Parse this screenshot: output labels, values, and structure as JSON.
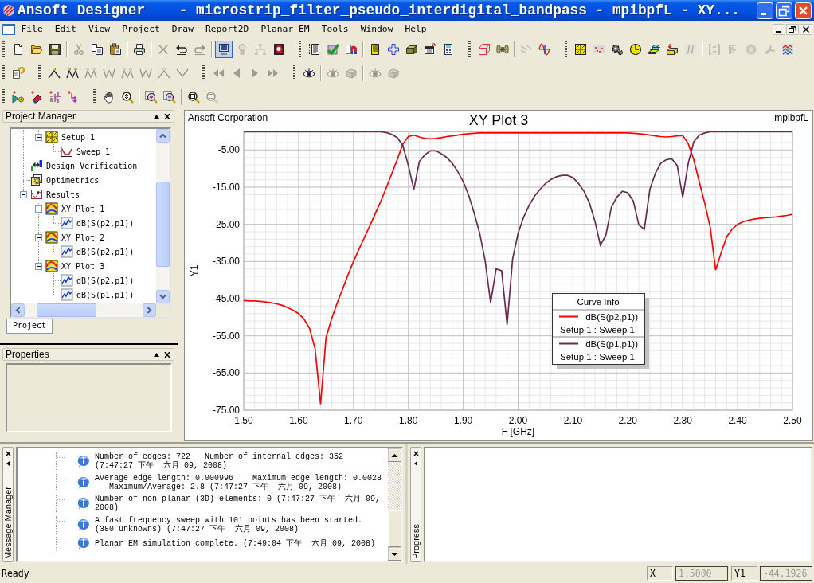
{
  "window": {
    "title": "Ansoft Designer    - microstrip_filter_pseudo_interdigital_bandpass - mpibpfL - XY..."
  },
  "menu_bar": {
    "items": [
      "File",
      "Edit",
      "View",
      "Project",
      "Draw",
      "Report2D",
      "Planar EM",
      "Tools",
      "Window",
      "Help"
    ]
  },
  "toolbars": [
    {
      "bands": [
        {
          "groups": [
            [
              {
                "disabled": false,
                "pressed": false
              },
              {
                "disabled": false,
                "pressed": false
              },
              {
                "disabled": false,
                "pressed": false
              }
            ],
            [
              {
                "disabled": true,
                "pressed": false
              },
              {
                "disabled": false,
                "pressed": false
              },
              {
                "disabled": false,
                "pressed": false
              }
            ],
            [
              {
                "disabled": false,
                "pressed": false
              }
            ],
            [
              {
                "disabled": true,
                "pressed": false
              },
              {
                "disabled": false,
                "pressed": false
              },
              {
                "disabled": true,
                "pressed": false
              }
            ],
            [
              {
                "disabled": false,
                "pressed": true
              },
              {
                "disabled": true,
                "pressed": false
              },
              {
                "disabled": true,
                "pressed": false
              },
              {
                "disabled": false,
                "pressed": false
              }
            ]
          ]
        },
        {
          "groups": [
            [
              {
                "disabled": false,
                "pressed": false
              },
              {
                "disabled": false,
                "pressed": false
              },
              {
                "disabled": false,
                "pressed": false
              }
            ],
            [
              {
                "disabled": false,
                "pressed": false
              },
              {
                "disabled": false,
                "pressed": false
              },
              {
                "disabled": false,
                "pressed": false
              },
              {
                "disabled": false,
                "pressed": false
              },
              {
                "disabled": false,
                "pressed": false
              }
            ]
          ]
        },
        {
          "groups": [
            [
              {
                "disabled": false,
                "pressed": false
              },
              {
                "disabled": false,
                "pressed": false
              }
            ],
            [
              {
                "disabled": true,
                "pressed": false
              },
              {
                "disabled": false,
                "pressed": false
              }
            ]
          ]
        },
        {
          "groups": [
            [
              {
                "disabled": false,
                "pressed": false
              },
              {
                "disabled": false,
                "pressed": false
              },
              {
                "disabled": false,
                "pressed": false
              },
              {
                "disabled": false,
                "pressed": false
              },
              {
                "disabled": false,
                "pressed": false
              },
              {
                "disabled": false,
                "pressed": false
              },
              {
                "disabled": true,
                "pressed": false
              }
            ],
            [
              {
                "disabled": true,
                "pressed": false
              },
              {
                "disabled": true,
                "pressed": false
              },
              {
                "disabled": true,
                "pressed": false
              },
              {
                "disabled": true,
                "pressed": false
              },
              {
                "disabled": false,
                "pressed": false
              }
            ]
          ]
        }
      ]
    },
    {
      "bands": [
        {
          "groups": [
            [
              {
                "disabled": false
              }
            ]
          ]
        },
        {
          "groups": [
            [
              {
                "disabled": false
              },
              {
                "disabled": false
              },
              {
                "disabled": true
              },
              {
                "disabled": true
              },
              {
                "disabled": true
              },
              {
                "disabled": true
              },
              {
                "disabled": true
              },
              {
                "disabled": true
              }
            ]
          ]
        },
        {
          "groups": [
            [
              {
                "disabled": true
              },
              {
                "disabled": true
              },
              {
                "disabled": true
              },
              {
                "disabled": true
              }
            ]
          ]
        },
        {
          "groups": [
            [
              {
                "disabled": false
              }
            ],
            [
              {
                "disabled": true
              },
              {
                "disabled": true
              }
            ],
            [
              {
                "disabled": true
              },
              {
                "disabled": true
              }
            ]
          ]
        }
      ]
    },
    {
      "bands": [
        {
          "groups": [
            [
              {
                "disabled": false
              },
              {
                "disabled": false
              },
              {
                "disabled": false
              },
              {
                "disabled": false
              }
            ]
          ]
        },
        {
          "groups": [
            [
              {
                "disabled": false
              },
              {
                "disabled": false
              }
            ],
            [
              {
                "disabled": false
              },
              {
                "disabled": false
              }
            ],
            [
              {
                "disabled": false
              },
              {
                "disabled": true
              }
            ]
          ]
        }
      ]
    }
  ],
  "project_manager": {
    "title": "Project Manager",
    "tree": [
      {
        "children": [
          {
            "label": "Setup 1",
            "kind": "setup",
            "expanded": true,
            "children": [
              {
                "label": "Sweep 1",
                "kind": "sweep"
              }
            ]
          }
        ]
      },
      {
        "label": "Design Verification",
        "kind": "verification"
      },
      {
        "label": "Optimetrics",
        "kind": "optimetrics"
      },
      {
        "label": "Results",
        "kind": "results",
        "expanded": true,
        "children": [
          {
            "label": "XY Plot 1",
            "kind": "plot",
            "expanded": true,
            "children": [
              {
                "label": "dB(S(p2,p1))",
                "kind": "trace"
              }
            ]
          },
          {
            "label": "XY Plot 2",
            "kind": "plot",
            "expanded": true,
            "children": [
              {
                "label": "dB(S(p2,p1))",
                "kind": "trace"
              }
            ]
          },
          {
            "label": "XY Plot 3",
            "kind": "plot",
            "expanded": true,
            "children": [
              {
                "label": "dB(S(p2,p1))",
                "kind": "trace"
              },
              {
                "label": "dB(S(p1,p1))",
                "kind": "trace"
              }
            ]
          }
        ]
      }
    ],
    "tabs": [
      {
        "label": "Project",
        "selected": true
      }
    ]
  },
  "properties": {
    "title": "Properties"
  },
  "plot": {
    "corner_left": "Ansoft Corporation",
    "corner_right": "mpibpfL",
    "chart_data": {
      "type": "line",
      "title": "XY Plot 3",
      "xlabel": "F [GHz]",
      "ylabel": "Y1",
      "grid": true,
      "legend": {
        "title": "Curve Info",
        "entries": [
          {
            "solution": "Setup 1 : Sweep 1"
          },
          {
            "solution": "Setup 1 : Sweep 1"
          }
        ]
      },
      "x": [
        1.5,
        1.51,
        1.52,
        1.53,
        1.54,
        1.55,
        1.56,
        1.57,
        1.58,
        1.59,
        1.6,
        1.61,
        1.62,
        1.63,
        1.64,
        1.65,
        1.66,
        1.67,
        1.68,
        1.69,
        1.7,
        1.71,
        1.72,
        1.73,
        1.74,
        1.75,
        1.76,
        1.77,
        1.78,
        1.79,
        1.8,
        1.81,
        1.82,
        1.83,
        1.84,
        1.85,
        1.86,
        1.87,
        1.88,
        1.89,
        1.9,
        1.91,
        1.92,
        1.93,
        1.94,
        1.95,
        1.96,
        1.97,
        1.98,
        1.99,
        2,
        2.01,
        2.02,
        2.03,
        2.04,
        2.05,
        2.06,
        2.07,
        2.08,
        2.09,
        2.1,
        2.11,
        2.12,
        2.13,
        2.14,
        2.15,
        2.16,
        2.17,
        2.18,
        2.19,
        2.2,
        2.21,
        2.22,
        2.23,
        2.24,
        2.25,
        2.26,
        2.27,
        2.28,
        2.29,
        2.3,
        2.31,
        2.32,
        2.33,
        2.34,
        2.35,
        2.36,
        2.37,
        2.38,
        2.39,
        2.4,
        2.41,
        2.42,
        2.43,
        2.44,
        2.45,
        2.46,
        2.47,
        2.48,
        2.49,
        2.5
      ],
      "series": [
        {
          "name": "dB(S(p2,p1))",
          "color": "#ff0000",
          "values": [
            -45.5,
            -45.6,
            -45.6,
            -45.7,
            -45.9,
            -46.1,
            -46.4,
            -46.8,
            -47.4,
            -48.1,
            -49,
            -50.5,
            -53,
            -58.5,
            -73.4,
            -55.5,
            -50.5,
            -46.3,
            -42.5,
            -38.6,
            -35,
            -31.7,
            -28.5,
            -25.3,
            -22,
            -18.7,
            -15.1,
            -11.3,
            -7.5,
            -3.4,
            -1.4,
            -1,
            -1.5,
            -1.9,
            -2,
            -1.9,
            -1.7,
            -1.4,
            -1.2,
            -1,
            -0.8,
            -0.6,
            -0.5,
            -0.4,
            -0.4,
            -0.4,
            -0.4,
            -0.4,
            -0.4,
            -0.4,
            -0.4,
            -0.4,
            -0.4,
            -0.4,
            -0.4,
            -0.4,
            -0.4,
            -0.4,
            -0.4,
            -0.4,
            -0.4,
            -0.4,
            -0.4,
            -0.4,
            -0.4,
            -0.4,
            -0.4,
            -0.4,
            -0.4,
            -0.4,
            -0.4,
            -0.5,
            -0.6,
            -0.8,
            -1,
            -1.2,
            -1.4,
            -1.5,
            -1.4,
            -1.2,
            -1.1,
            -3.3,
            -7.6,
            -13.5,
            -19.3,
            -25.8,
            -37.3,
            -32.7,
            -28.4,
            -26.3,
            -25,
            -24.3,
            -23.9,
            -23.6,
            -23.4,
            -23.2,
            -23.1,
            -23,
            -22.8,
            -22.6,
            -22.3
          ]
        },
        {
          "name": "dB(S(p1,p1))",
          "color": "#6a2c4c",
          "values": [
            -0.1,
            -0.1,
            -0.1,
            -0.1,
            -0.1,
            -0.1,
            -0.1,
            -0.1,
            -0.1,
            -0.1,
            -0.1,
            -0.1,
            -0.1,
            -0.1,
            -0.1,
            -0.1,
            -0.1,
            -0.1,
            -0.1,
            -0.1,
            -0.1,
            -0.1,
            -0.1,
            -0.1,
            -0.1,
            -0.1,
            -0.3,
            -0.8,
            -1.7,
            -3.8,
            -9.2,
            -15.6,
            -8.1,
            -6.3,
            -5.2,
            -5.2,
            -6,
            -7,
            -8.6,
            -10.8,
            -13.5,
            -17.2,
            -22,
            -27.4,
            -34.9,
            -46.1,
            -37,
            -37.5,
            -52,
            -34.3,
            -27.4,
            -23.1,
            -19.9,
            -17.4,
            -15.6,
            -14,
            -12.9,
            -12.2,
            -11.8,
            -11.8,
            -12.4,
            -14,
            -16.1,
            -19.3,
            -24.2,
            -30.6,
            -27.9,
            -20.4,
            -17.7,
            -16.1,
            -16.5,
            -18.8,
            -25.2,
            -26.3,
            -15.6,
            -11.3,
            -8.6,
            -7.6,
            -7.4,
            -9.2,
            -17.7,
            -8.6,
            -2.8,
            -1,
            -0.4,
            -0.1,
            -0.1,
            -0.1,
            -0.1,
            -0.1,
            -0.1,
            -0.1,
            -0.1,
            -0.1,
            -0.1,
            -0.1,
            -0.1,
            -0.1,
            -0.1,
            -0.1,
            -0.1
          ]
        }
      ],
      "xlim": [
        1.5,
        2.5
      ],
      "ylim": [
        -75,
        0
      ],
      "xticks": [
        {
          "value": 1.5,
          "label": "1.50"
        },
        {
          "value": 1.6,
          "label": "1.60"
        },
        {
          "value": 1.7,
          "label": "1.70"
        },
        {
          "value": 1.8,
          "label": "1.80"
        },
        {
          "value": 1.9,
          "label": "1.90"
        },
        {
          "value": 2,
          "label": "2.00"
        },
        {
          "value": 2.1,
          "label": "2.10"
        },
        {
          "value": 2.2,
          "label": "2.20"
        },
        {
          "value": 2.3,
          "label": "2.30"
        },
        {
          "value": 2.4,
          "label": "2.40"
        },
        {
          "value": 2.5,
          "label": "2.50"
        }
      ],
      "yticks": [
        {
          "value": -75,
          "label": "-75.00"
        },
        {
          "value": -65,
          "label": "-65.00"
        },
        {
          "value": -55,
          "label": "-55.00"
        },
        {
          "value": -45,
          "label": "-45.00"
        },
        {
          "value": -35,
          "label": "-35.00"
        },
        {
          "value": -25,
          "label": "-25.00"
        },
        {
          "value": -15,
          "label": "-15.00"
        },
        {
          "value": -5,
          "label": "-5.00"
        }
      ]
    }
  },
  "message_manager": {
    "title": "Message Manager",
    "messages": [
      {
        "kind": "info",
        "text": "Number of edges: 722   Number of internal edges: 352 (7:47:27 下午  六月 09, 2008)"
      },
      {
        "kind": "info",
        "text": "Average edge length: 0.000996    Maximum edge length: 0.0028\n   Maximum/Average: 2.8 (7:47:27 下午  六月 09, 2008)"
      },
      {
        "kind": "info",
        "text": "Number of non-planar (3D) elements: 0 (7:47:27 下午  六月 09, 2008)"
      },
      {
        "kind": "info",
        "text": "A fast frequency sweep with 101 points has been started. (380 unknowns) (7:47:27 下午  六月 09, 2008)"
      },
      {
        "kind": "info",
        "text": "Planar EM simulation complete. (7:49:04 下午  六月 09, 2008)"
      }
    ]
  },
  "progress": {
    "title": "Progress"
  },
  "status_bar": {
    "text": "Ready",
    "readouts": [
      {
        "label": "X",
        "value": "1.5000"
      },
      {
        "label": "Y1",
        "value": "-44.1926"
      }
    ]
  }
}
